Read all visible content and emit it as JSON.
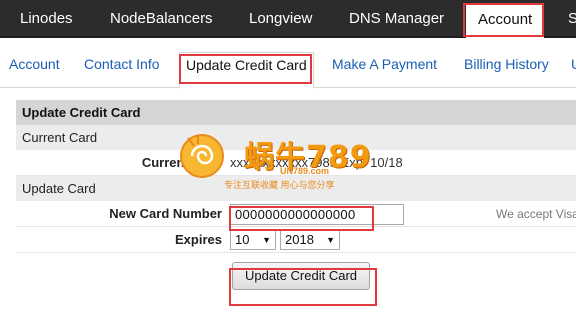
{
  "topnav": {
    "items": [
      "Linodes",
      "NodeBalancers",
      "Longview",
      "DNS Manager",
      "Account",
      "S"
    ],
    "active": "Account"
  },
  "subnav": {
    "items": [
      "Account",
      "Contact Info",
      "Update Credit Card",
      "Make A Payment",
      "Billing History",
      "U"
    ],
    "active": "Update Credit Card"
  },
  "panel": {
    "title": "Update Credit Card",
    "current_section": "Current Card",
    "current_card_label": "Current Card",
    "current_card_value": "xxxxxxxxxxxx7985  Exp: 10/18",
    "update_section": "Update Card",
    "new_card_label": "New Card Number",
    "new_card_value": "0000000000000000",
    "accept_text": "We accept Visa",
    "expires_label": "Expires",
    "expires_month": "10",
    "expires_year": "2018",
    "submit_label": "Update Credit Card"
  },
  "watermark": {
    "big_text": "蜗牛789",
    "url": "UN789.com",
    "slogan": "专注互联收藏  用心与您分享"
  },
  "colors": {
    "topnav_bg": "#2c2c2c",
    "link": "#1a5fb4",
    "highlight": "#e0393e",
    "panel_header": "#d5d5d5",
    "watermark": "#f39a11"
  },
  "icons": [
    "dropdown-arrow-icon",
    "snail-logo"
  ]
}
